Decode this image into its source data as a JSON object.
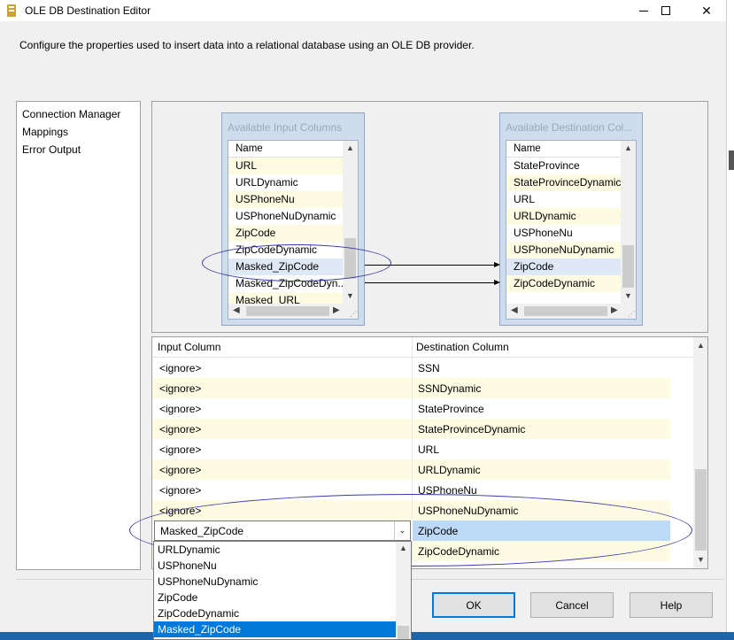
{
  "window": {
    "title": "OLE DB Destination Editor",
    "minimize_glyph": "",
    "maximize_glyph": "",
    "close_glyph": "✕"
  },
  "description": "Configure the properties used to insert data into a relational database using an OLE DB provider.",
  "nav": {
    "items": [
      "Connection Manager",
      "Mappings",
      "Error Output"
    ]
  },
  "available_input": {
    "title": "Available Input Columns",
    "header": "Name",
    "rows": [
      "URL",
      "URLDynamic",
      "USPhoneNu",
      "USPhoneNuDynamic",
      "ZipCode",
      "ZipCodeDynamic",
      "Masked_ZipCode",
      "Masked_ZipCodeDyn...",
      "Masked_URL"
    ]
  },
  "available_destination": {
    "title": "Available Destination Col...",
    "header": "Name",
    "rows": [
      "StateProvince",
      "StateProvinceDynamic",
      "URL",
      "URLDynamic",
      "USPhoneNu",
      "USPhoneNuDynamic",
      "ZipCode",
      "ZipCodeDynamic"
    ]
  },
  "mapping_grid": {
    "headers": {
      "input": "Input Column",
      "destination": "Destination Column"
    },
    "rows": [
      {
        "input": "<ignore>",
        "destination": "SSN"
      },
      {
        "input": "<ignore>",
        "destination": "SSNDynamic"
      },
      {
        "input": "<ignore>",
        "destination": "StateProvince"
      },
      {
        "input": "<ignore>",
        "destination": "StateProvinceDynamic"
      },
      {
        "input": "<ignore>",
        "destination": "URL"
      },
      {
        "input": "<ignore>",
        "destination": "URLDynamic"
      },
      {
        "input": "<ignore>",
        "destination": "USPhoneNu"
      },
      {
        "input": "<ignore>",
        "destination": "USPhoneNuDynamic"
      }
    ],
    "selected_row": {
      "input": "Masked_ZipCode",
      "destination": "ZipCode"
    },
    "next_row": {
      "destination": "ZipCodeDynamic"
    }
  },
  "dropdown": {
    "options": [
      "URLDynamic",
      "USPhoneNu",
      "USPhoneNuDynamic",
      "ZipCode",
      "ZipCodeDynamic",
      "Masked_ZipCode"
    ],
    "selected": "Masked_ZipCode"
  },
  "buttons": {
    "ok": "OK",
    "cancel": "Cancel",
    "help": "Help"
  },
  "colors": {
    "accent": "#0078d7",
    "row_alt": "#fdfbe2",
    "selection": "#bcd9f7",
    "ellipse": "#3a3aa8"
  }
}
